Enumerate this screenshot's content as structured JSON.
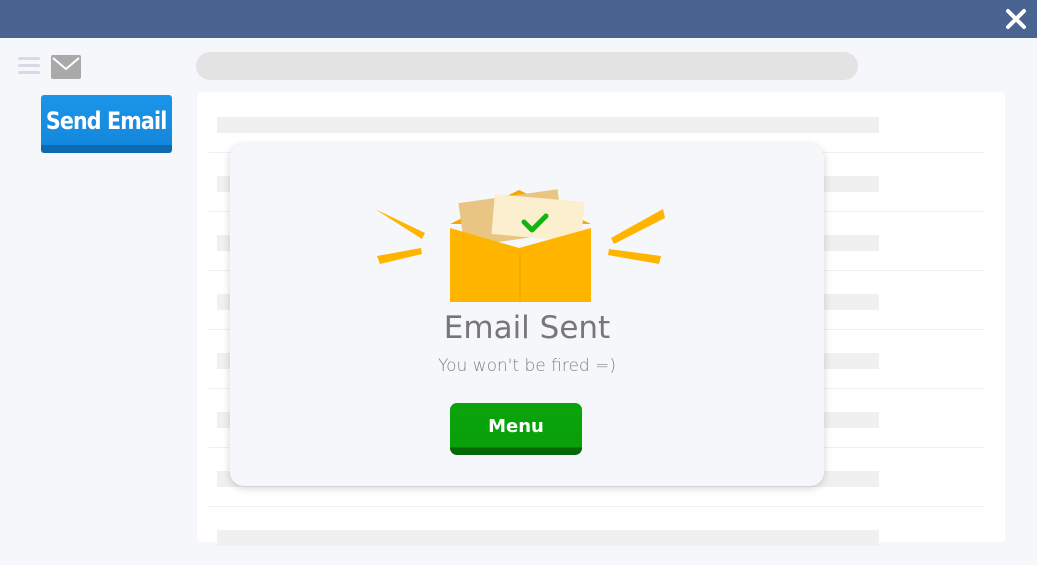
{
  "titlebar": {
    "close_icon": "close-icon",
    "color": "#4a6491"
  },
  "sidebar": {
    "menu_icon": "hamburger-menu-icon",
    "mail_icon": "envelope-icon",
    "send_button_label": "Send Email",
    "send_button_color": "#1b95e8"
  },
  "modal": {
    "icon": "envelope-check-icon",
    "title": "Email Sent",
    "subtitle": "You won't be fired =)",
    "menu_button_label": "Menu",
    "menu_button_color": "#0aa40a"
  }
}
